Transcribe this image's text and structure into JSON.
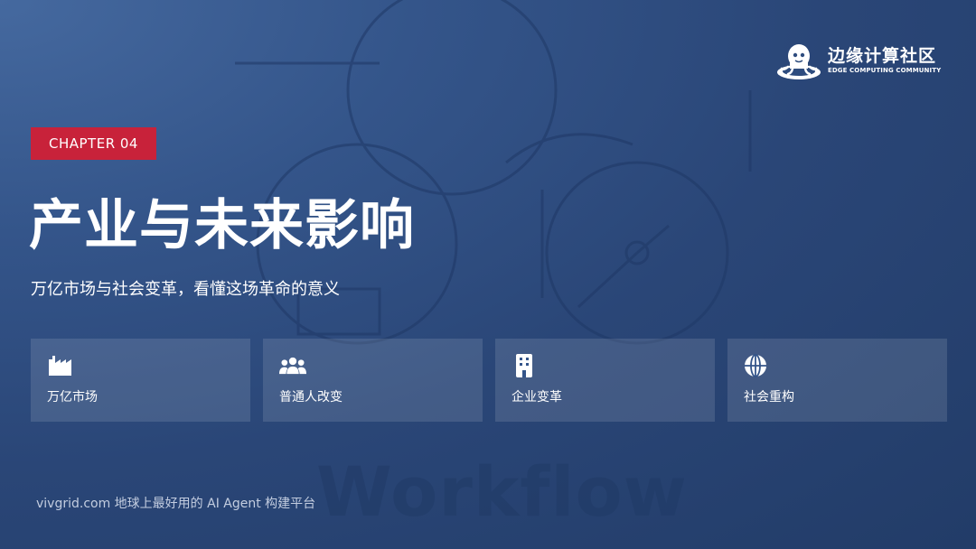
{
  "logo": {
    "name_cn": "边缘计算社区",
    "name_en": "EDGE COMPUTING COMMUNITY"
  },
  "chapter_label": "CHAPTER 04",
  "title": "产业与未来影响",
  "subtitle": "万亿市场与社会变革，看懂这场革命的意义",
  "cards": [
    {
      "icon": "factory-icon",
      "label": "万亿市场"
    },
    {
      "icon": "users-icon",
      "label": "普通人改变"
    },
    {
      "icon": "building-icon",
      "label": "企业变革"
    },
    {
      "icon": "globe-icon",
      "label": "社会重构"
    }
  ],
  "footer": "vivgrid.com 地球上最好用的 AI Agent 构建平台",
  "watermark_text": "Workflow",
  "colors": {
    "background": "#2a4677",
    "accent_red": "#c8223a",
    "text": "#ffffff",
    "footer_text": "#c3cde0"
  }
}
